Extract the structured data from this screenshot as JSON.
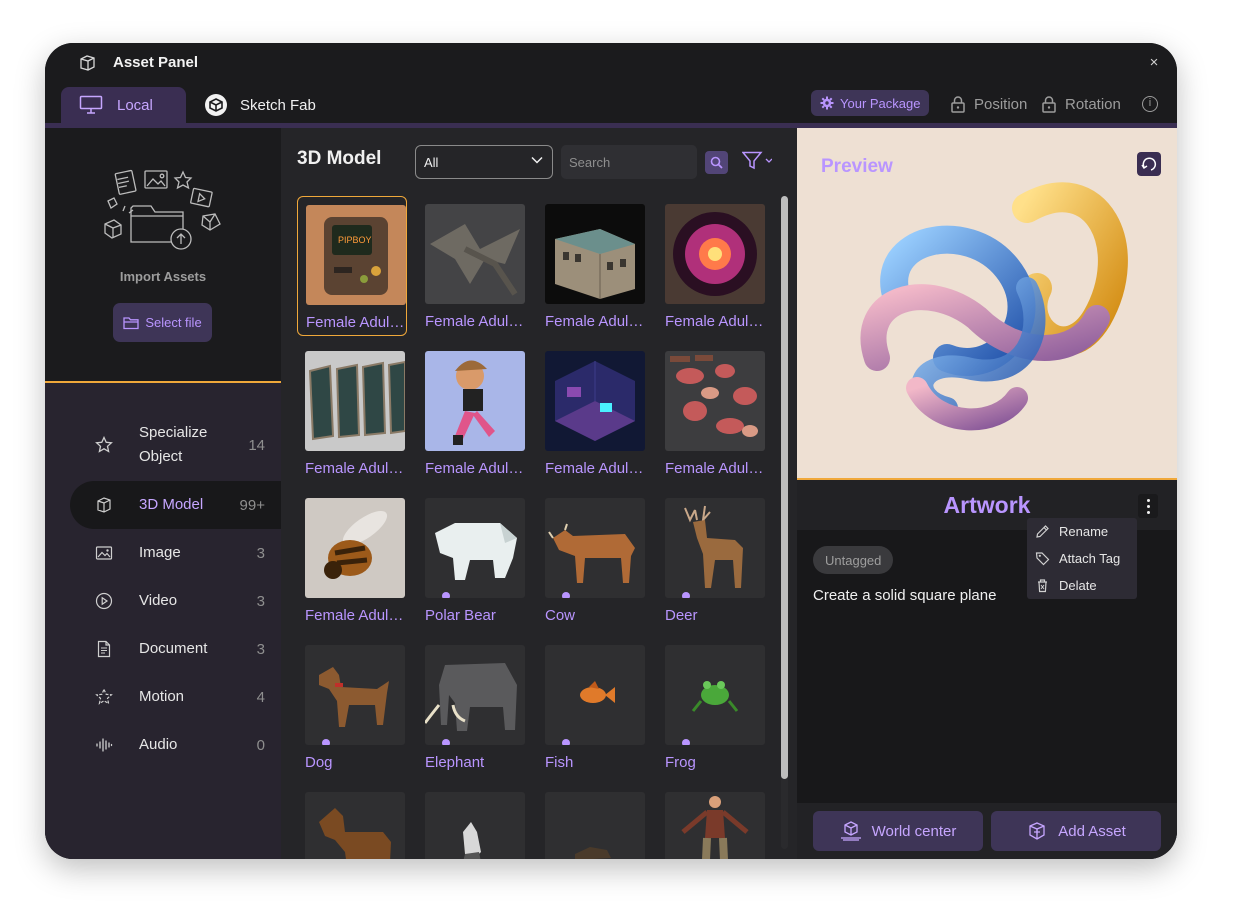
{
  "window": {
    "title": "Asset Panel",
    "close_label": "×"
  },
  "tabs": [
    {
      "label": "Local"
    },
    {
      "label": "Sketch Fab"
    }
  ],
  "header": {
    "package_label": "Your Package",
    "position_label": "Position",
    "rotation_label": "Rotation",
    "info_label": "i"
  },
  "import": {
    "label": "Import Assets",
    "button": "Select file"
  },
  "categories": [
    {
      "label": "Specialize Object",
      "count": "14"
    },
    {
      "label": "3D Model",
      "count": "99+"
    },
    {
      "label": "Image",
      "count": "3"
    },
    {
      "label": "Video",
      "count": "3"
    },
    {
      "label": "Document",
      "count": "3"
    },
    {
      "label": "Motion",
      "count": "4"
    },
    {
      "label": "Audio",
      "count": "0"
    }
  ],
  "grid": {
    "title": "3D Model",
    "filter_value": "All",
    "search_placeholder": "Search",
    "items": [
      {
        "name": "Female Adult Character",
        "icon": "pipboy-device"
      },
      {
        "name": "Female Adult Character",
        "icon": "dragon"
      },
      {
        "name": "Female Adult Character",
        "icon": "building"
      },
      {
        "name": "Female Adult Character",
        "icon": "energy-orb"
      },
      {
        "name": "Female Adult Character",
        "icon": "signboards"
      },
      {
        "name": "Female Adult Character",
        "icon": "cartoon-girl"
      },
      {
        "name": "Female Adult Character",
        "icon": "isometric-room"
      },
      {
        "name": "Female Adult Character",
        "icon": "meat-props"
      },
      {
        "name": "Female Adult Character",
        "icon": "bee"
      },
      {
        "name": "Polar Bear",
        "icon": "polar-bear"
      },
      {
        "name": "Cow",
        "icon": "cow"
      },
      {
        "name": "Deer",
        "icon": "deer"
      },
      {
        "name": "Dog",
        "icon": "dog"
      },
      {
        "name": "Elephant",
        "icon": "elephant"
      },
      {
        "name": "Fish",
        "icon": "fish"
      },
      {
        "name": "Frog",
        "icon": "frog"
      },
      {
        "name": "",
        "icon": "horse"
      },
      {
        "name": "",
        "icon": "animal"
      },
      {
        "name": "",
        "icon": "animal"
      },
      {
        "name": "",
        "icon": "human-figure"
      }
    ]
  },
  "preview": {
    "label": "Preview"
  },
  "artwork": {
    "title": "Artwork",
    "tag": "Untagged",
    "description": "Create a solid square plane"
  },
  "context_menu": [
    {
      "label": "Rename",
      "icon": "pencil-icon"
    },
    {
      "label": "Attach Tag",
      "icon": "tag-icon"
    },
    {
      "label": "Delate",
      "icon": "trash-icon"
    }
  ],
  "actions": {
    "world_center": "World center",
    "add_asset": "Add Asset"
  },
  "colors": {
    "accent": "#b995ff",
    "highlight": "#f0a83a",
    "panel": "#1b1b1d"
  }
}
